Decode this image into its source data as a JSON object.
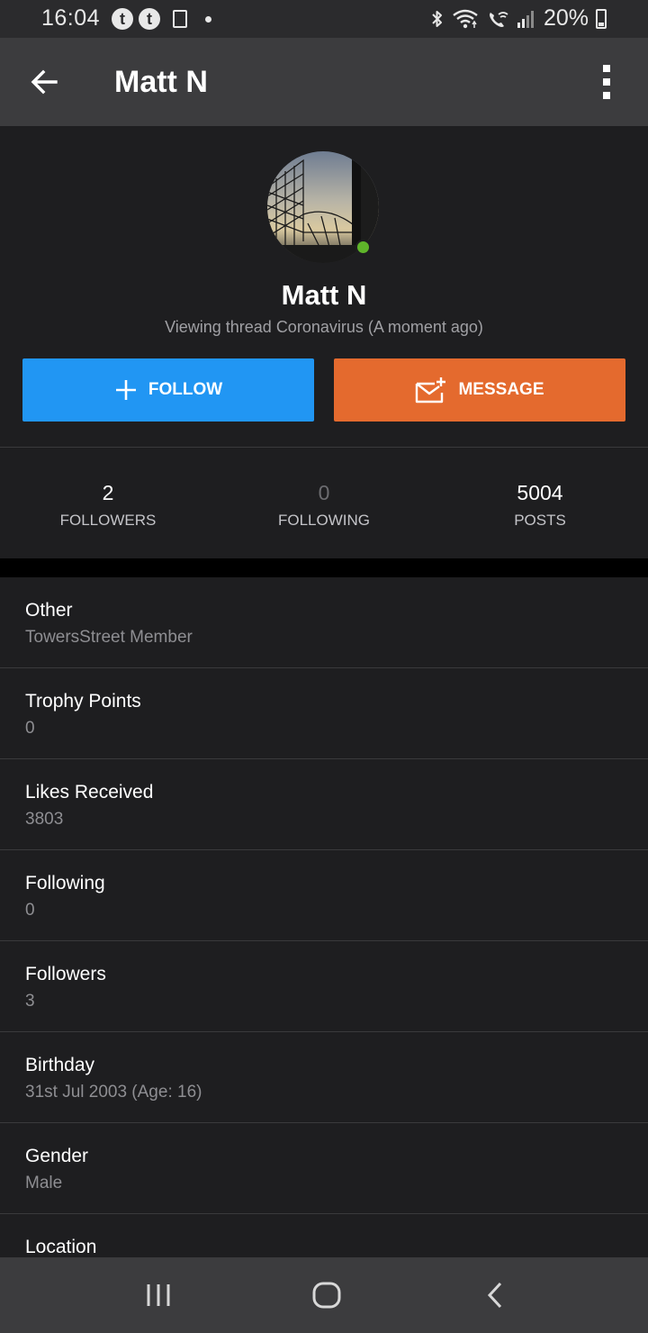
{
  "status_bar": {
    "time": "16:04",
    "notification_icons": [
      "tumblr-icon",
      "tumblr-icon",
      "sim-card-icon",
      "dot-icon"
    ],
    "system_icons": [
      "bluetooth-icon",
      "wifi-icon",
      "wifi-calling-icon",
      "signal-icon"
    ],
    "battery_text": "20%"
  },
  "app_bar": {
    "title": "Matt N",
    "back_icon": "arrow-back-icon",
    "menu_icon": "more-vert-icon"
  },
  "profile": {
    "name": "Matt N",
    "status": "Viewing thread Coronavirus (A moment ago)",
    "online": true,
    "online_color": "#5fb52a",
    "follow_label": "FOLLOW",
    "follow_color": "#2196f3",
    "message_label": "MESSAGE",
    "message_color": "#e46a2e"
  },
  "stats": [
    {
      "value": "2",
      "label": "FOLLOWERS"
    },
    {
      "value": "0",
      "label": "FOLLOWING"
    },
    {
      "value": "5004",
      "label": "POSTS"
    }
  ],
  "info": [
    {
      "label": "Other",
      "value": "TowersStreet Member"
    },
    {
      "label": "Trophy Points",
      "value": "0"
    },
    {
      "label": "Likes Received",
      "value": "3803"
    },
    {
      "label": "Following",
      "value": "0"
    },
    {
      "label": "Followers",
      "value": "3"
    },
    {
      "label": "Birthday",
      "value": "31st Jul 2003 (Age: 16)"
    },
    {
      "label": "Gender",
      "value": "Male"
    },
    {
      "label": "Location",
      "value": ""
    }
  ],
  "nav_bar": {
    "icons": [
      "recent-apps-icon",
      "home-icon",
      "back-icon"
    ]
  }
}
